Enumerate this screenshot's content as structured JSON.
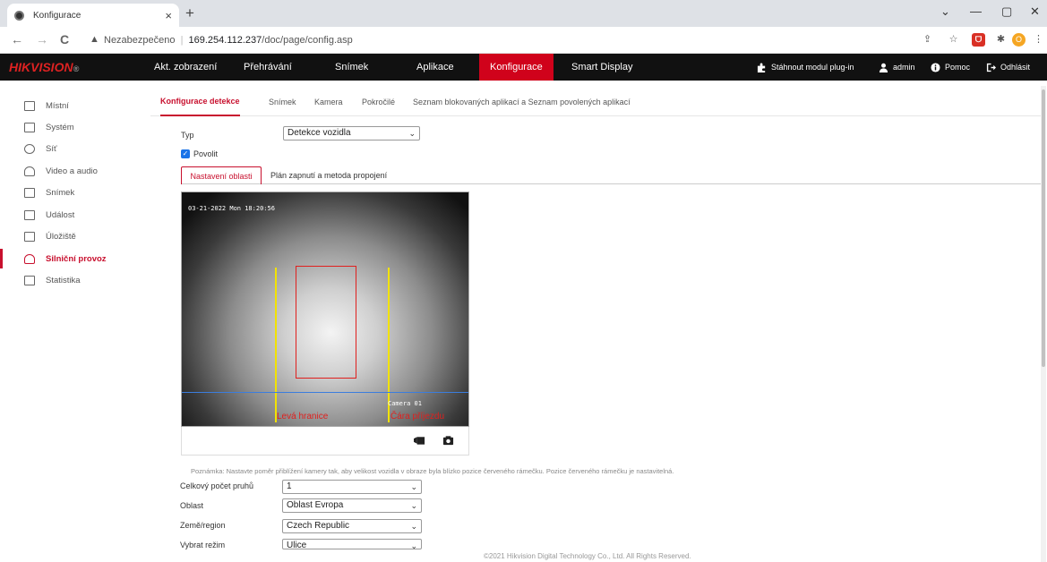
{
  "browser": {
    "tab_title": "Konfigurace",
    "tab_close": "×",
    "new_tab": "+",
    "window_controls": [
      "⌄",
      "—",
      "▢",
      "✕"
    ],
    "nav": {
      "back": "←",
      "forward": "→",
      "reload": "C"
    },
    "omnibox": {
      "security_label": "Nezabezpečeno",
      "separator": "|",
      "url_host": "169.254.112.237",
      "url_path": "/doc/page/config.asp"
    },
    "extensions": [
      {
        "name": "share-icon",
        "glyph": "⇪"
      },
      {
        "name": "star-icon",
        "glyph": "☆"
      },
      {
        "name": "pdf-extension-icon",
        "glyph": "ᗜ"
      },
      {
        "name": "puzzle-extension-icon",
        "glyph": "✱"
      },
      {
        "name": "profile-avatar",
        "glyph": "O"
      },
      {
        "name": "menu-kebab-icon",
        "glyph": "⋮"
      }
    ]
  },
  "app": {
    "logo": "HIKVISION",
    "logo_mark": "®",
    "menu": [
      {
        "label": "Akt. zobrazení",
        "active": false
      },
      {
        "label": "Přehrávání",
        "active": false
      },
      {
        "label": "Snímek",
        "active": false
      },
      {
        "label": "Aplikace",
        "active": false
      },
      {
        "label": "Konfigurace",
        "active": true
      },
      {
        "label": "Smart Display",
        "active": false
      }
    ],
    "right_links": {
      "plugin": "Stáhnout modul plug-in",
      "user": "admin",
      "help": "Pomoc",
      "logout": "Odhlásit"
    }
  },
  "sidebar": {
    "items": [
      {
        "label": "Místní",
        "icon": "monitor-icon",
        "active": false
      },
      {
        "label": "Systém",
        "icon": "system-icon",
        "active": false
      },
      {
        "label": "Síť",
        "icon": "globe-icon",
        "active": false
      },
      {
        "label": "Video a audio",
        "icon": "video-audio-icon",
        "active": false
      },
      {
        "label": "Snímek",
        "icon": "image-icon",
        "active": false
      },
      {
        "label": "Událost",
        "icon": "calendar-icon",
        "active": false
      },
      {
        "label": "Úložiště",
        "icon": "storage-icon",
        "active": false
      },
      {
        "label": "Silniční provoz",
        "icon": "road-traffic-icon",
        "active": true
      },
      {
        "label": "Statistika",
        "icon": "statistics-icon",
        "active": false
      }
    ]
  },
  "subtabs": [
    {
      "label": "Konfigurace detekce",
      "active": true
    },
    {
      "label": "Snímek",
      "active": false
    },
    {
      "label": "Kamera",
      "active": false
    },
    {
      "label": "Pokročilé",
      "active": false
    },
    {
      "label": "Seznam blokovaných aplikací a Seznam povolených aplikací",
      "active": false
    }
  ],
  "form": {
    "type_label": "Typ",
    "type_value": "Detekce vozidla",
    "enable_label": "Povolit",
    "enable_checked": true,
    "area_tabs": [
      {
        "label": "Nastavení oblasti",
        "active": true
      },
      {
        "label": "Plán zapnutí a metoda propojení",
        "active": false
      }
    ],
    "note": "Poznámka: Nastavte poměr přiblížení kamery tak, aby velikost vozidla v obraze byla blízko pozice červeného rámečku. Pozice červeného rámečku je nastavitelná.",
    "fields": [
      {
        "label": "Celkový počet pruhů",
        "value": "1"
      },
      {
        "label": "Oblast",
        "value": "Oblast Evropa"
      },
      {
        "label": "Země/region",
        "value": "Czech Republic"
      },
      {
        "label": "Vybrat režim",
        "value": "Ulice"
      }
    ]
  },
  "video": {
    "timestamp": "03-21-2022 Mon 18:20:56",
    "camera_label": "Camera 01",
    "left_boundary_label": "Levá hranice",
    "line_label": "Čára příjezdu",
    "colors": {
      "boundary": "#f2e200",
      "detection_box": "#e0201e",
      "trigger_line": "#3b7ddd"
    }
  },
  "footer": "©2021 Hikvision Digital Technology Co., Ltd. All Rights Reserved.",
  "theme": {
    "accent": "#c8102e",
    "topnav_bg": "#111111"
  }
}
